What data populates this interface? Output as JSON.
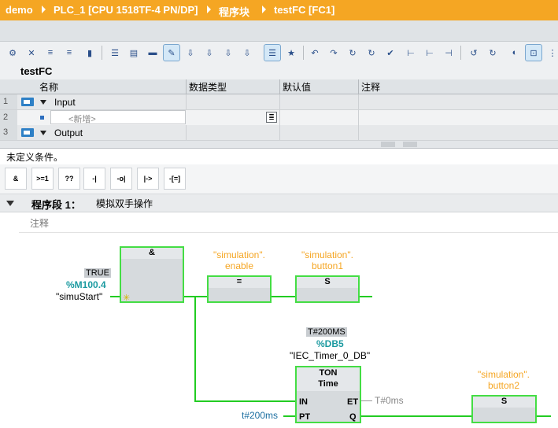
{
  "breadcrumb": {
    "items": [
      "demo",
      "PLC_1 [CPU 1518TF-4 PN/DP]",
      "程序块",
      "testFC [FC1]"
    ]
  },
  "block": {
    "name": "testFC"
  },
  "interface_table": {
    "columns": [
      "名称",
      "数据类型",
      "默认值",
      "注释"
    ],
    "rows": [
      {
        "num": "1",
        "name": "Input",
        "kind": "section"
      },
      {
        "num": "2",
        "name": "<新增>",
        "kind": "add"
      },
      {
        "num": "3",
        "name": "Output",
        "kind": "section"
      }
    ]
  },
  "status": {
    "text": "未定义条件。"
  },
  "favorites": [
    "&",
    ">=1",
    "??",
    "-|",
    "-o|",
    "|->",
    "-[=]"
  ],
  "network": {
    "title": "程序段 1：",
    "subtitle": "模拟双手操作",
    "comment_placeholder": "注释"
  },
  "ladder": {
    "and_box": {
      "title": "&"
    },
    "in1_value": "TRUE",
    "in1_addr": "%M100.4",
    "in1_tag": "\"simuStart\"",
    "coil1_tag_line1": "\"simulation\".",
    "coil1_tag_line2": "enable",
    "coil1_symbol": "=",
    "coil2_tag_line1": "\"simulation\".",
    "coil2_tag_line2": "button1",
    "coil2_symbol": "S",
    "timer_value": "T#200MS",
    "timer_db": "%DB5",
    "timer_instance": "\"IEC_Timer_0_DB\"",
    "timer_type": "TON",
    "timer_subtype": "Time",
    "pin_in": "IN",
    "pin_pt": "PT",
    "pin_et": "ET",
    "pin_q": "Q",
    "et_value": "T#0ms",
    "pt_value": "t#200ms",
    "coil3_tag_line1": "\"simulation\".",
    "coil3_tag_line2": "button2",
    "coil3_symbol": "S"
  },
  "colors": {
    "accent": "#f5a623",
    "wire": "#22cc22",
    "box_border": "#44dd44",
    "address": "#1b9aa0"
  }
}
